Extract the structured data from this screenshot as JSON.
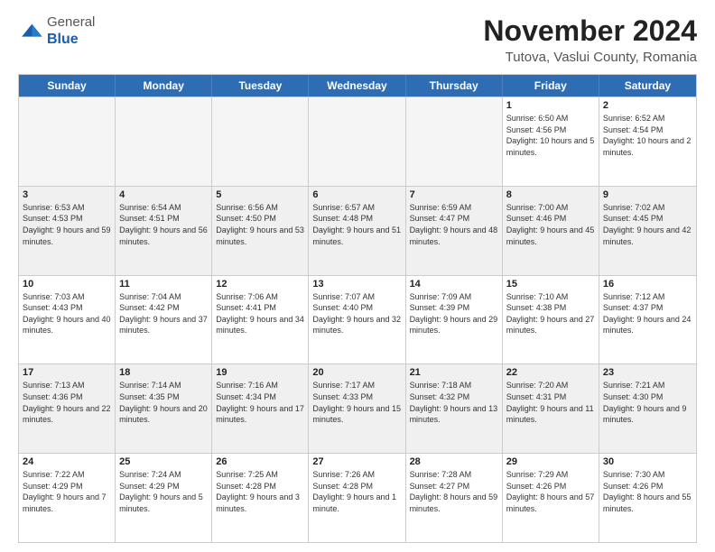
{
  "header": {
    "logo": {
      "line1": "General",
      "line2": "Blue"
    },
    "title": "November 2024",
    "subtitle": "Tutova, Vaslui County, Romania"
  },
  "calendar": {
    "days_of_week": [
      "Sunday",
      "Monday",
      "Tuesday",
      "Wednesday",
      "Thursday",
      "Friday",
      "Saturday"
    ],
    "weeks": [
      [
        {
          "day": "",
          "empty": true
        },
        {
          "day": "",
          "empty": true
        },
        {
          "day": "",
          "empty": true
        },
        {
          "day": "",
          "empty": true
        },
        {
          "day": "",
          "empty": true
        },
        {
          "day": "1",
          "sunrise": "6:50 AM",
          "sunset": "4:56 PM",
          "daylight": "10 hours and 5 minutes."
        },
        {
          "day": "2",
          "sunrise": "6:52 AM",
          "sunset": "4:54 PM",
          "daylight": "10 hours and 2 minutes."
        }
      ],
      [
        {
          "day": "3",
          "sunrise": "6:53 AM",
          "sunset": "4:53 PM",
          "daylight": "9 hours and 59 minutes."
        },
        {
          "day": "4",
          "sunrise": "6:54 AM",
          "sunset": "4:51 PM",
          "daylight": "9 hours and 56 minutes."
        },
        {
          "day": "5",
          "sunrise": "6:56 AM",
          "sunset": "4:50 PM",
          "daylight": "9 hours and 53 minutes."
        },
        {
          "day": "6",
          "sunrise": "6:57 AM",
          "sunset": "4:48 PM",
          "daylight": "9 hours and 51 minutes."
        },
        {
          "day": "7",
          "sunrise": "6:59 AM",
          "sunset": "4:47 PM",
          "daylight": "9 hours and 48 minutes."
        },
        {
          "day": "8",
          "sunrise": "7:00 AM",
          "sunset": "4:46 PM",
          "daylight": "9 hours and 45 minutes."
        },
        {
          "day": "9",
          "sunrise": "7:02 AM",
          "sunset": "4:45 PM",
          "daylight": "9 hours and 42 minutes."
        }
      ],
      [
        {
          "day": "10",
          "sunrise": "7:03 AM",
          "sunset": "4:43 PM",
          "daylight": "9 hours and 40 minutes."
        },
        {
          "day": "11",
          "sunrise": "7:04 AM",
          "sunset": "4:42 PM",
          "daylight": "9 hours and 37 minutes."
        },
        {
          "day": "12",
          "sunrise": "7:06 AM",
          "sunset": "4:41 PM",
          "daylight": "9 hours and 34 minutes."
        },
        {
          "day": "13",
          "sunrise": "7:07 AM",
          "sunset": "4:40 PM",
          "daylight": "9 hours and 32 minutes."
        },
        {
          "day": "14",
          "sunrise": "7:09 AM",
          "sunset": "4:39 PM",
          "daylight": "9 hours and 29 minutes."
        },
        {
          "day": "15",
          "sunrise": "7:10 AM",
          "sunset": "4:38 PM",
          "daylight": "9 hours and 27 minutes."
        },
        {
          "day": "16",
          "sunrise": "7:12 AM",
          "sunset": "4:37 PM",
          "daylight": "9 hours and 24 minutes."
        }
      ],
      [
        {
          "day": "17",
          "sunrise": "7:13 AM",
          "sunset": "4:36 PM",
          "daylight": "9 hours and 22 minutes."
        },
        {
          "day": "18",
          "sunrise": "7:14 AM",
          "sunset": "4:35 PM",
          "daylight": "9 hours and 20 minutes."
        },
        {
          "day": "19",
          "sunrise": "7:16 AM",
          "sunset": "4:34 PM",
          "daylight": "9 hours and 17 minutes."
        },
        {
          "day": "20",
          "sunrise": "7:17 AM",
          "sunset": "4:33 PM",
          "daylight": "9 hours and 15 minutes."
        },
        {
          "day": "21",
          "sunrise": "7:18 AM",
          "sunset": "4:32 PM",
          "daylight": "9 hours and 13 minutes."
        },
        {
          "day": "22",
          "sunrise": "7:20 AM",
          "sunset": "4:31 PM",
          "daylight": "9 hours and 11 minutes."
        },
        {
          "day": "23",
          "sunrise": "7:21 AM",
          "sunset": "4:30 PM",
          "daylight": "9 hours and 9 minutes."
        }
      ],
      [
        {
          "day": "24",
          "sunrise": "7:22 AM",
          "sunset": "4:29 PM",
          "daylight": "9 hours and 7 minutes."
        },
        {
          "day": "25",
          "sunrise": "7:24 AM",
          "sunset": "4:29 PM",
          "daylight": "9 hours and 5 minutes."
        },
        {
          "day": "26",
          "sunrise": "7:25 AM",
          "sunset": "4:28 PM",
          "daylight": "9 hours and 3 minutes."
        },
        {
          "day": "27",
          "sunrise": "7:26 AM",
          "sunset": "4:28 PM",
          "daylight": "9 hours and 1 minute."
        },
        {
          "day": "28",
          "sunrise": "7:28 AM",
          "sunset": "4:27 PM",
          "daylight": "8 hours and 59 minutes."
        },
        {
          "day": "29",
          "sunrise": "7:29 AM",
          "sunset": "4:26 PM",
          "daylight": "8 hours and 57 minutes."
        },
        {
          "day": "30",
          "sunrise": "7:30 AM",
          "sunset": "4:26 PM",
          "daylight": "8 hours and 55 minutes."
        }
      ]
    ]
  }
}
